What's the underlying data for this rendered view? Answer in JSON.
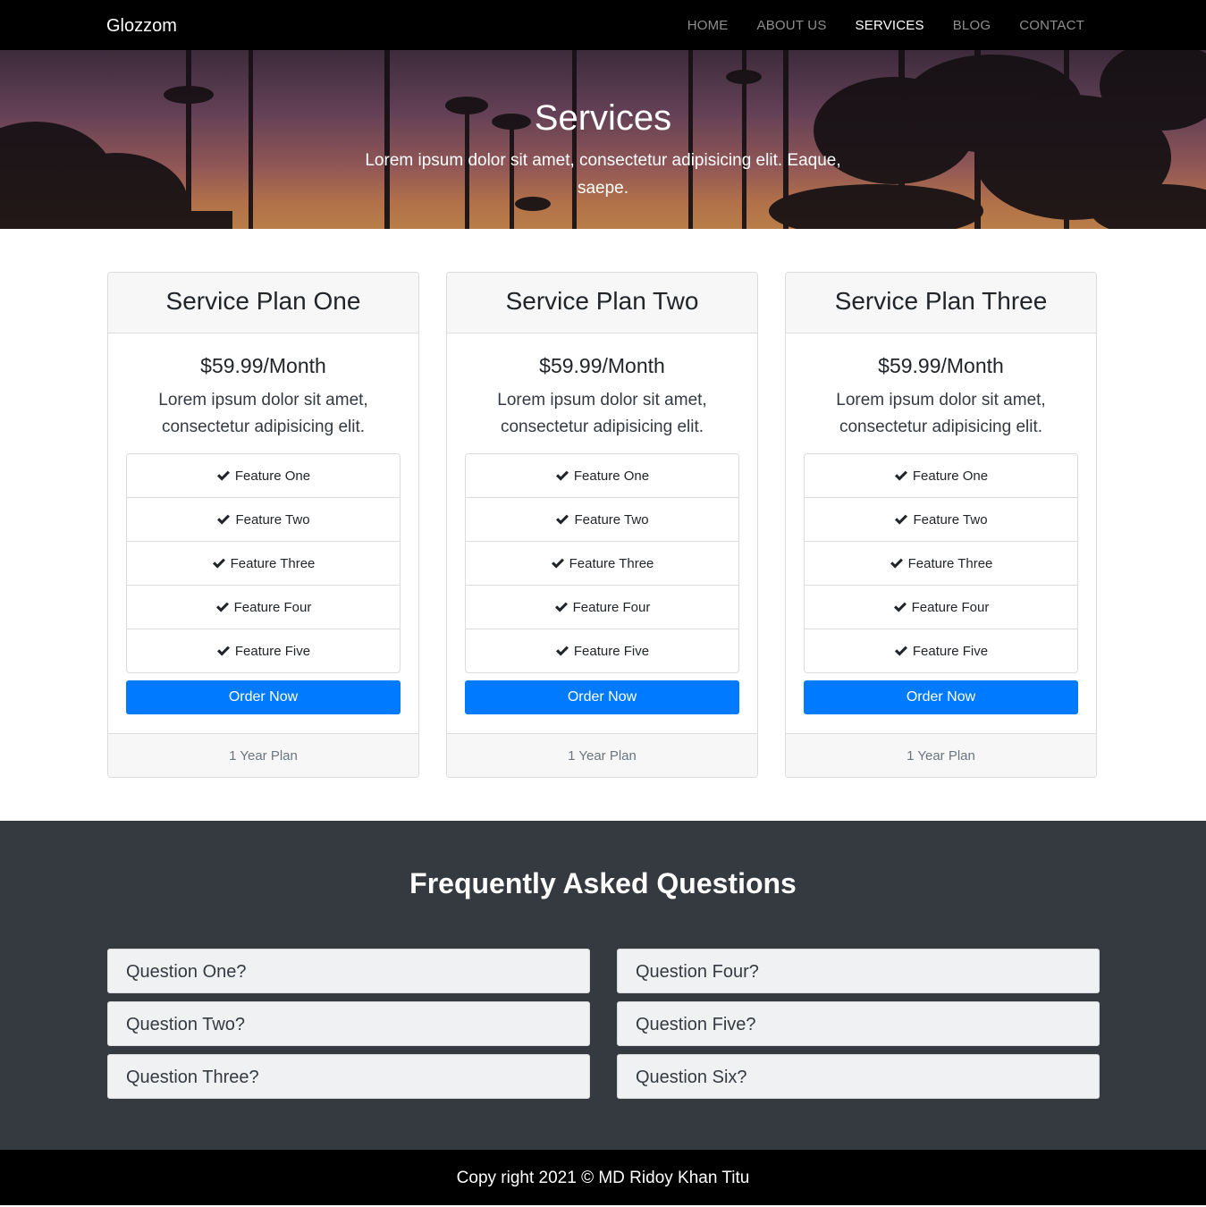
{
  "navbar": {
    "brand": "Glozzom",
    "links": [
      "HOME",
      "ABOUT US",
      "SERVICES",
      "BLOG",
      "CONTACT"
    ],
    "active": "SERVICES"
  },
  "hero": {
    "title": "Services",
    "text": "Lorem ipsum dolor sit amet, consectetur adipisicing elit. Eaque, saepe."
  },
  "plans": [
    {
      "title": "Service Plan One",
      "price": "$59.99/Month",
      "description": "Lorem ipsum dolor sit amet, consectetur adipisicing elit.",
      "features": [
        "Feature One",
        "Feature Two",
        "Feature Three",
        "Feature Four",
        "Feature Five"
      ],
      "button": "Order Now",
      "footer": "1 Year Plan"
    },
    {
      "title": "Service Plan Two",
      "price": "$59.99/Month",
      "description": "Lorem ipsum dolor sit amet, consectetur adipisicing elit.",
      "features": [
        "Feature One",
        "Feature Two",
        "Feature Three",
        "Feature Four",
        "Feature Five"
      ],
      "button": "Order Now",
      "footer": "1 Year Plan"
    },
    {
      "title": "Service Plan Three",
      "price": "$59.99/Month",
      "description": "Lorem ipsum dolor sit amet, consectetur adipisicing elit.",
      "features": [
        "Feature One",
        "Feature Two",
        "Feature Three",
        "Feature Four",
        "Feature Five"
      ],
      "button": "Order Now",
      "footer": "1 Year Plan"
    }
  ],
  "faq": {
    "title": "Frequently Asked Questions",
    "questions": [
      "Question One?",
      "Question Two?",
      "Question Three?",
      "Question Four?",
      "Question Five?",
      "Question Six?"
    ]
  },
  "footer": {
    "text": "Copy right 2021 © MD Ridoy Khan Titu"
  },
  "colors": {
    "primary": "#007bff",
    "navbar": "#000000",
    "faq_bg": "#343a40"
  },
  "icons": {
    "feature": "check-icon",
    "hero_background": "palm-trees-sunset"
  }
}
